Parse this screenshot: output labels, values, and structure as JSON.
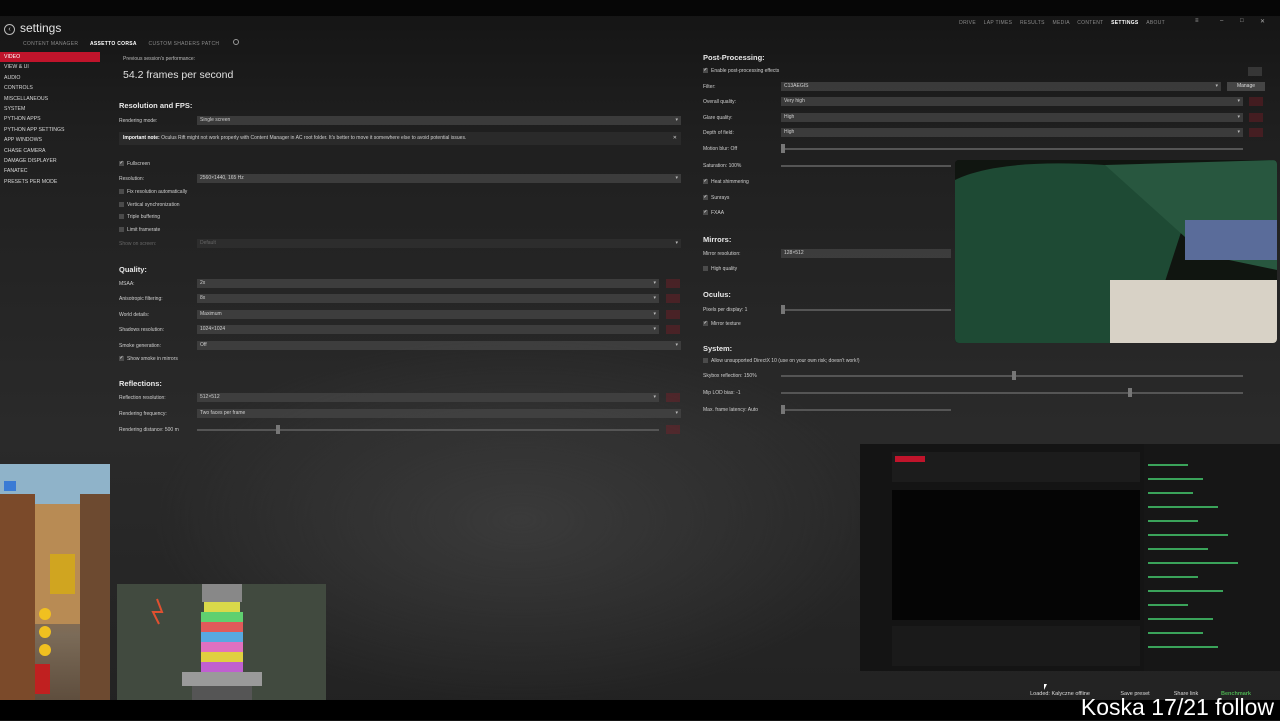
{
  "app": {
    "title": "settings"
  },
  "subtabs": [
    "CONTENT MANAGER",
    "ASSETTO CORSA",
    "CUSTOM SHADERS PATCH"
  ],
  "topnav": [
    "DRIVE",
    "LAP TIMES",
    "RESULTS",
    "MEDIA",
    "CONTENT",
    "SETTINGS",
    "ABOUT"
  ],
  "sidebar": [
    "VIDEO",
    "VIEW & UI",
    "AUDIO",
    "CONTROLS",
    "MISCELLANEOUS",
    "SYSTEM",
    "PYTHON APPS",
    "PYTHON APP SETTINGS",
    "APP WINDOWS",
    "CHASE CAMERA",
    "DAMAGE DISPLAYER",
    "FANATEC",
    "PRESETS PER MODE"
  ],
  "perf": {
    "title": "Previous session's performance:",
    "value": "54.2 frames per second"
  },
  "resolution_fps": {
    "heading": "Resolution and FPS:",
    "rendering_mode_label": "Rendering mode:",
    "rendering_mode": "Single screen",
    "note_bold": "Important note:",
    "note": "Oculus Rift might not work properly with Content Manager in AC root folder. It's better to move it somewhere else to avoid potential issues.",
    "fullscreen": "Fullscreen",
    "resolution_label": "Resolution:",
    "resolution": "2560×1440, 165 Hz",
    "fix_res": "Fix resolution automatically",
    "vsync": "Vertical synchronization",
    "triple": "Triple buffering",
    "limit": "Limit framerate",
    "show_on_screen_label": "Show on screen:",
    "show_on_screen": "Default"
  },
  "quality": {
    "heading": "Quality:",
    "msaa_label": "MSAA:",
    "msaa": "2x",
    "aniso_label": "Anisotropic filtering:",
    "aniso": "8x",
    "world_label": "World details:",
    "world": "Maximum",
    "shadows_label": "Shadows resolution:",
    "shadows": "1024×1024",
    "smoke_label": "Smoke generation:",
    "smoke": "Off",
    "smoke_mirrors": "Show smoke in mirrors"
  },
  "reflections": {
    "heading": "Reflections:",
    "res_label": "Reflection resolution:",
    "res": "512×512",
    "freq_label": "Rendering frequency:",
    "freq": "Two faces per frame",
    "dist_label": "Rendering distance: 500 m",
    "dist_fraction": 0.17
  },
  "post": {
    "heading": "Post-Processing:",
    "enable": "Enable post-processing effects",
    "filter_label": "Filter:",
    "filter": "C13AEGIS",
    "manage": "Manage",
    "overall_label": "Overall quality:",
    "overall": "Very high",
    "glare_label": "Glare quality:",
    "glare": "High",
    "dof_label": "Depth of field:",
    "dof": "High",
    "motion_label": "Motion blur: Off",
    "sat_label": "Saturation: 100%",
    "heat": "Heat shimmering",
    "sunrays": "Sunrays",
    "fxaa": "FXAA"
  },
  "mirrors": {
    "heading": "Mirrors:",
    "res_label": "Mirror resolution:",
    "res": "128×512",
    "hq": "High quality"
  },
  "oculus": {
    "heading": "Oculus:",
    "ppd_label": "Pixels per display: 1",
    "mirror_tex": "Mirror texture"
  },
  "system": {
    "heading": "System:",
    "dx10": "Allow unsupported DirectX 10 (use on your own risk; doesn't work!)",
    "skybox_label": "Skybox reflection: 150%",
    "mip_label": "Mip LOD bias: -1",
    "latency_label": "Max. frame latency: Auto",
    "skybox_fraction": 0.5,
    "mip_fraction": 0.75
  },
  "bottom": {
    "preset": "Loaded: Kalyczne offline",
    "save": "Save preset",
    "share": "Share link",
    "benchmark": "Benchmark"
  },
  "overlay": "Koska 17/21 follow",
  "colors": {
    "accent": "#c0142b",
    "benchmark": "#4caf50"
  }
}
